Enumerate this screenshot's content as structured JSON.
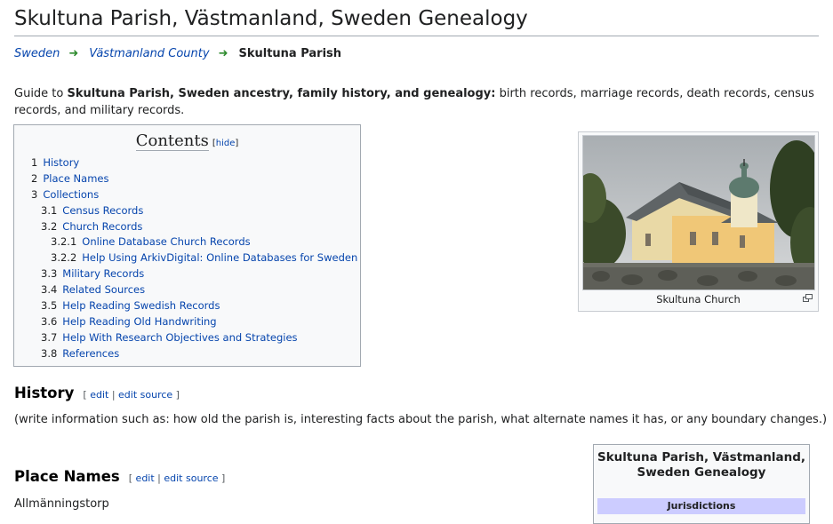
{
  "page": {
    "title": "Skultuna Parish, Västmanland, Sweden Genealogy"
  },
  "breadcrumb": {
    "items": [
      "Sweden",
      "Västmanland County"
    ],
    "current": "Skultuna Parish"
  },
  "intro": {
    "prefix": "Guide to ",
    "bold": "Skultuna Parish, Sweden ancestry, family history, and genealogy:",
    "suffix": " birth records, marriage records, death records, census records, and military records."
  },
  "toc": {
    "title": "Contents",
    "hide_label": "hide",
    "items": [
      {
        "num": "1",
        "label": "History"
      },
      {
        "num": "2",
        "label": "Place Names"
      },
      {
        "num": "3",
        "label": "Collections"
      },
      {
        "num": "3.1",
        "label": "Census Records"
      },
      {
        "num": "3.2",
        "label": "Church Records"
      },
      {
        "num": "3.2.1",
        "label": "Online Database Church Records"
      },
      {
        "num": "3.2.2",
        "label": "Help Using ArkivDigital: Online Databases for Sweden"
      },
      {
        "num": "3.3",
        "label": "Military Records"
      },
      {
        "num": "3.4",
        "label": "Related Sources"
      },
      {
        "num": "3.5",
        "label": "Help Reading Swedish Records"
      },
      {
        "num": "3.6",
        "label": "Help Reading Old Handwriting"
      },
      {
        "num": "3.7",
        "label": "Help With Research Objectives and Strategies"
      },
      {
        "num": "3.8",
        "label": "References"
      }
    ]
  },
  "thumb": {
    "caption": "Skultuna Church",
    "icon": "magnify-icon"
  },
  "sections": {
    "history": {
      "heading": "History",
      "edit": "edit",
      "edit_source": "edit source",
      "text": "(write information such as: how old the parish is, interesting facts about the parish, what alternate names it has, or any boundary changes.)"
    },
    "place_names": {
      "heading": "Place Names",
      "edit": "edit",
      "edit_source": "edit source",
      "first_item": "Allmänningstorp"
    }
  },
  "infobox": {
    "title": "Skultuna Parish, Västmanland, Sweden Genealogy",
    "subheader": "Jurisdictions"
  },
  "colors": {
    "link": "#0645ad",
    "arrow": "#2e8b2e",
    "infobox_header": "#ccccff"
  }
}
